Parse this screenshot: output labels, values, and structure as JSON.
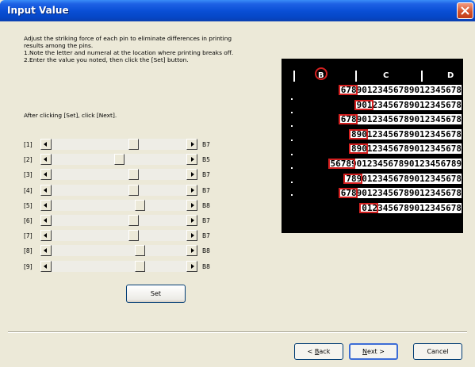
{
  "window": {
    "title": "Input Value"
  },
  "instructions": [
    "Adjust the striking force of each pin to eliminate differences in printing",
    "results among the pins.",
    "1.Note the letter and numeral at the location where printing breaks off.",
    "2.Enter the value you noted, then click the [Set] button."
  ],
  "after_text": "After clicking [Set], click [Next].",
  "pins": [
    {
      "label": "[1]",
      "value": "B7",
      "level": 0.62
    },
    {
      "label": "[2]",
      "value": "B5",
      "level": 0.5
    },
    {
      "label": "[3]",
      "value": "B7",
      "level": 0.62
    },
    {
      "label": "[4]",
      "value": "B7",
      "level": 0.62
    },
    {
      "label": "[5]",
      "value": "B8",
      "level": 0.67
    },
    {
      "label": "[6]",
      "value": "B7",
      "level": 0.62
    },
    {
      "label": "[7]",
      "value": "B7",
      "level": 0.62
    },
    {
      "label": "[8]",
      "value": "B8",
      "level": 0.67
    },
    {
      "label": "[9]",
      "value": "B8",
      "level": 0.67
    }
  ],
  "preview": {
    "columns": [
      "B",
      "C",
      "D"
    ],
    "rows": [
      "67890123456789012345678",
      "90123456789012345678",
      "67890123456789012345678",
      "890123456789012345678",
      "890123456789012345678",
      "5678901234567890123456789",
      "7890123456789012345678",
      "67890123456789012345678",
      "0123456789012345678"
    ]
  },
  "buttons": {
    "set": "Set",
    "back_prefix": "< ",
    "back_key": "B",
    "back_rest": "ack",
    "next_key": "N",
    "next_rest": "ext >",
    "cancel": "Cancel"
  },
  "colors": {
    "title_bar": "#0a4fd6",
    "highlight": "#d42020",
    "dialog_bg": "#ece9d8"
  }
}
